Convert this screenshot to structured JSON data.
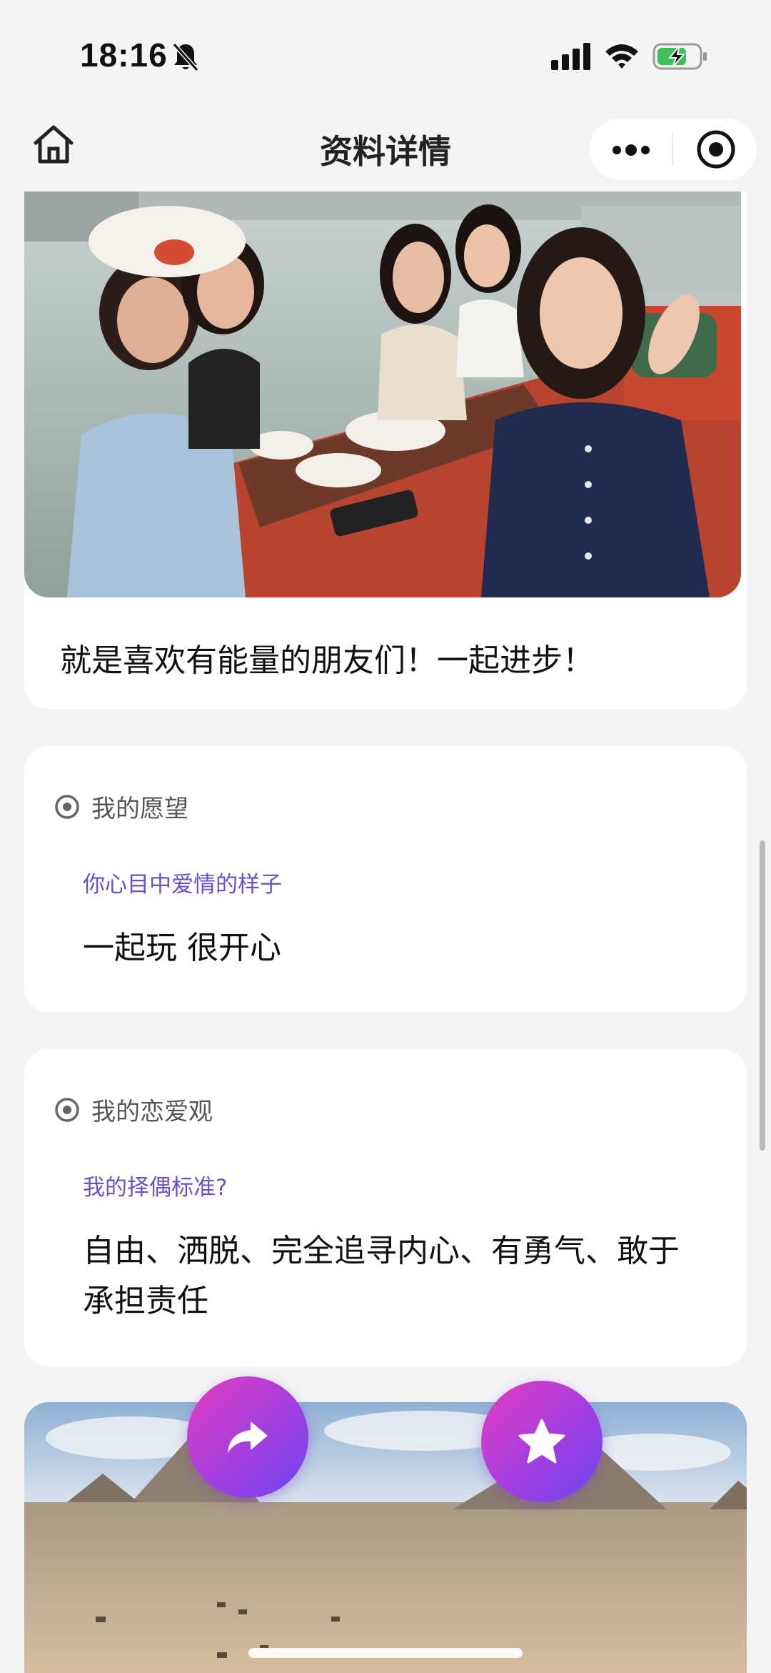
{
  "status_bar": {
    "time": "18:16",
    "icons": [
      "bell-off-icon",
      "signal-icon",
      "wifi-icon",
      "battery-charging-icon"
    ]
  },
  "nav": {
    "title": "资料详情",
    "icons": [
      "home-icon",
      "more-icon",
      "target-icon"
    ]
  },
  "photo_card": {
    "caption": "就是喜欢有能量的朋友们！一起进步！"
  },
  "wish_card": {
    "section_title": "我的愿望",
    "question": "你心目中爱情的样子",
    "answer": "一起玩 很开心"
  },
  "love_card": {
    "section_title": "我的恋爱观",
    "question": "我的择偶标准?",
    "answer": "自由、洒脱、完全追寻内心、有勇气、敢于承担责任"
  },
  "fabs": {
    "share_icon": "share-icon",
    "favorite_icon": "star-icon"
  },
  "colors": {
    "background": "#f4f4f5",
    "accent_question": "#6a4fd0",
    "fab_gradient_start": "#e43fc0",
    "fab_gradient_end": "#6d46f0"
  }
}
